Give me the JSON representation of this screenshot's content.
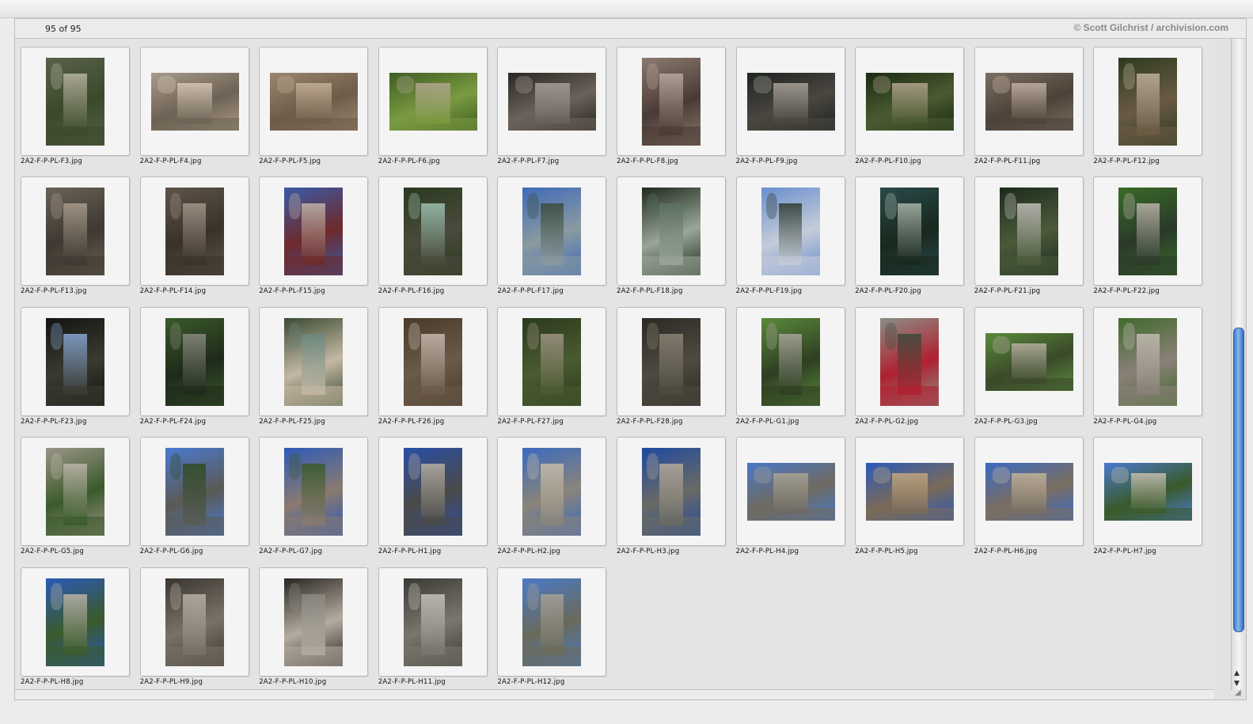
{
  "header": {
    "count": "95 of 95",
    "copyright": "© Scott Gilchrist / archivision.com"
  },
  "colors": {
    "window_bg": "#e2e2e2",
    "frame": "#f4f4f4",
    "scroll_accent": "#3a78c8"
  },
  "scroll": {
    "position": 0.47,
    "visible_fraction": 0.53
  },
  "icons": {
    "scroll_up": "▲",
    "scroll_down": "▼",
    "resize": "◢"
  },
  "thumbnails": [
    {
      "file": "2A2-F-P-PL-F3.jpg",
      "orient": "portrait",
      "palette": [
        "#58604a",
        "#b8b4a2",
        "#3a4a2a"
      ]
    },
    {
      "file": "2A2-F-P-PL-F4.jpg",
      "orient": "landscape",
      "palette": [
        "#a89a8a",
        "#d6c9b8",
        "#6e6254"
      ]
    },
    {
      "file": "2A2-F-P-PL-F5.jpg",
      "orient": "landscape",
      "palette": [
        "#9a8670",
        "#c7b29a",
        "#6d5c48"
      ]
    },
    {
      "file": "2A2-F-P-PL-F6.jpg",
      "orient": "landscape",
      "palette": [
        "#3f5c24",
        "#b2a590",
        "#7a9a40"
      ]
    },
    {
      "file": "2A2-F-P-PL-F7.jpg",
      "orient": "landscape",
      "palette": [
        "#2a2622",
        "#a8a09a",
        "#6a625a"
      ]
    },
    {
      "file": "2A2-F-P-PL-F8.jpg",
      "orient": "portrait",
      "palette": [
        "#8a7a70",
        "#b8aaa0",
        "#4a3a34"
      ]
    },
    {
      "file": "2A2-F-P-PL-F9.jpg",
      "orient": "landscape",
      "palette": [
        "#1e2422",
        "#aaa49a",
        "#4a4640"
      ]
    },
    {
      "file": "2A2-F-P-PL-F10.jpg",
      "orient": "landscape",
      "palette": [
        "#1a2a14",
        "#b4a690",
        "#4a5a30"
      ]
    },
    {
      "file": "2A2-F-P-PL-F11.jpg",
      "orient": "landscape",
      "palette": [
        "#7a6e62",
        "#c2b4a4",
        "#4e4238"
      ]
    },
    {
      "file": "2A2-F-P-PL-F12.jpg",
      "orient": "portrait",
      "palette": [
        "#2c3a1e",
        "#c0b2a0",
        "#6a5a44"
      ]
    },
    {
      "file": "2A2-F-P-PL-F13.jpg",
      "orient": "portrait",
      "palette": [
        "#6a6258",
        "#a89c8c",
        "#3e3830"
      ]
    },
    {
      "file": "2A2-F-P-PL-F14.jpg",
      "orient": "portrait",
      "palette": [
        "#5e5448",
        "#a4968a",
        "#3a322a"
      ]
    },
    {
      "file": "2A2-F-P-PL-F15.jpg",
      "orient": "portrait",
      "palette": [
        "#3a5aa8",
        "#c0b4a8",
        "#6e2a2a"
      ]
    },
    {
      "file": "2A2-F-P-PL-F16.jpg",
      "orient": "portrait",
      "palette": [
        "#2a3a20",
        "#9ec4b4",
        "#4a4a3a"
      ]
    },
    {
      "file": "2A2-F-P-PL-F17.jpg",
      "orient": "portrait",
      "palette": [
        "#3e6ab8",
        "#3a4a3a",
        "#8a9aa0"
      ]
    },
    {
      "file": "2A2-F-P-PL-F18.jpg",
      "orient": "portrait",
      "palette": [
        "#1e2a1a",
        "#5a7060",
        "#9aa69a"
      ]
    },
    {
      "file": "2A2-F-P-PL-F19.jpg",
      "orient": "portrait",
      "palette": [
        "#6a8ed0",
        "#2e3a2e",
        "#c4ccd8"
      ]
    },
    {
      "file": "2A2-F-P-PL-F20.jpg",
      "orient": "portrait",
      "palette": [
        "#2a4a4a",
        "#a8b4a8",
        "#18281e"
      ]
    },
    {
      "file": "2A2-F-P-PL-F21.jpg",
      "orient": "portrait",
      "palette": [
        "#1c2a1c",
        "#c4c0bc",
        "#4a5a3a"
      ]
    },
    {
      "file": "2A2-F-P-PL-F22.jpg",
      "orient": "portrait",
      "palette": [
        "#3a6a28",
        "#bcb4aa",
        "#2a3a2a"
      ]
    },
    {
      "file": "2A2-F-P-PL-F23.jpg",
      "orient": "portrait",
      "palette": [
        "#141414",
        "#8aa8d8",
        "#3a3a30"
      ]
    },
    {
      "file": "2A2-F-P-PL-F24.jpg",
      "orient": "portrait",
      "palette": [
        "#3a5a2a",
        "#8a8a80",
        "#1e2a1a"
      ]
    },
    {
      "file": "2A2-F-P-PL-F25.jpg",
      "orient": "portrait",
      "palette": [
        "#3a4a30",
        "#6a8880",
        "#c4b8a4"
      ]
    },
    {
      "file": "2A2-F-P-PL-F26.jpg",
      "orient": "portrait",
      "palette": [
        "#4a3a2a",
        "#c8bcb0",
        "#6a5a4a"
      ]
    },
    {
      "file": "2A2-F-P-PL-F27.jpg",
      "orient": "portrait",
      "palette": [
        "#2a3a1e",
        "#a09484",
        "#4a5a30"
      ]
    },
    {
      "file": "2A2-F-P-PL-F28.jpg",
      "orient": "portrait",
      "palette": [
        "#2a2a24",
        "#8a8474",
        "#4e4a40"
      ]
    },
    {
      "file": "2A2-F-P-PL-G1.jpg",
      "orient": "portrait",
      "palette": [
        "#5a8a3a",
        "#a8a49c",
        "#2e3e22"
      ]
    },
    {
      "file": "2A2-F-P-PL-G2.jpg",
      "orient": "portrait",
      "palette": [
        "#8a8e86",
        "#3a4a3a",
        "#b02030"
      ]
    },
    {
      "file": "2A2-F-P-PL-G3.jpg",
      "orient": "landscape",
      "palette": [
        "#5a8a3a",
        "#b8b0a4",
        "#3a4a2a"
      ]
    },
    {
      "file": "2A2-F-P-PL-G4.jpg",
      "orient": "portrait",
      "palette": [
        "#3e6a2a",
        "#c4bcb4",
        "#8a8078"
      ]
    },
    {
      "file": "2A2-F-P-PL-G5.jpg",
      "orient": "portrait",
      "palette": [
        "#9a9488",
        "#bcb6aa",
        "#3a5a2a"
      ]
    },
    {
      "file": "2A2-F-P-PL-G6.jpg",
      "orient": "portrait",
      "palette": [
        "#4a7ad0",
        "#2e4a22",
        "#5a5a54"
      ]
    },
    {
      "file": "2A2-F-P-PL-G7.jpg",
      "orient": "portrait",
      "palette": [
        "#2e5ab8",
        "#3a5a2a",
        "#8a7a70"
      ]
    },
    {
      "file": "2A2-F-P-PL-H1.jpg",
      "orient": "portrait",
      "palette": [
        "#2a4ea8",
        "#b8b0a0",
        "#4a4a48"
      ]
    },
    {
      "file": "2A2-F-P-PL-H2.jpg",
      "orient": "portrait",
      "palette": [
        "#3a6ac0",
        "#c8bca8",
        "#8a847a"
      ]
    },
    {
      "file": "2A2-F-P-PL-H3.jpg",
      "orient": "portrait",
      "palette": [
        "#1e4aa0",
        "#b4aa9a",
        "#6a6a64"
      ]
    },
    {
      "file": "2A2-F-P-PL-H4.jpg",
      "orient": "landscape",
      "palette": [
        "#4a78c8",
        "#aca494",
        "#6e6a60"
      ]
    },
    {
      "file": "2A2-F-P-PL-H5.jpg",
      "orient": "landscape",
      "palette": [
        "#2a5ab8",
        "#c4a880",
        "#7a6a58"
      ]
    },
    {
      "file": "2A2-F-P-PL-H6.jpg",
      "orient": "landscape",
      "palette": [
        "#3a6ac4",
        "#c4b49a",
        "#7a6e60"
      ]
    },
    {
      "file": "2A2-F-P-PL-H7.jpg",
      "orient": "landscape",
      "palette": [
        "#4a7ad0",
        "#c8c0b0",
        "#3a5a2a"
      ]
    },
    {
      "file": "2A2-F-P-PL-H8.jpg",
      "orient": "portrait",
      "palette": [
        "#2a5ab8",
        "#bcb4a8",
        "#3a5a2a"
      ]
    },
    {
      "file": "2A2-F-P-PL-H9.jpg",
      "orient": "portrait",
      "palette": [
        "#3a3630",
        "#b8b2a8",
        "#7a7268"
      ]
    },
    {
      "file": "2A2-F-P-PL-H10.jpg",
      "orient": "portrait",
      "palette": [
        "#2a2622",
        "#8a8880",
        "#b4aca0"
      ]
    },
    {
      "file": "2A2-F-P-PL-H11.jpg",
      "orient": "portrait",
      "palette": [
        "#3a3a34",
        "#c8c4bc",
        "#7a766e"
      ]
    },
    {
      "file": "2A2-F-P-PL-H12.jpg",
      "orient": "portrait",
      "palette": [
        "#4a7ac8",
        "#a8a096",
        "#6a6a5a"
      ]
    }
  ]
}
